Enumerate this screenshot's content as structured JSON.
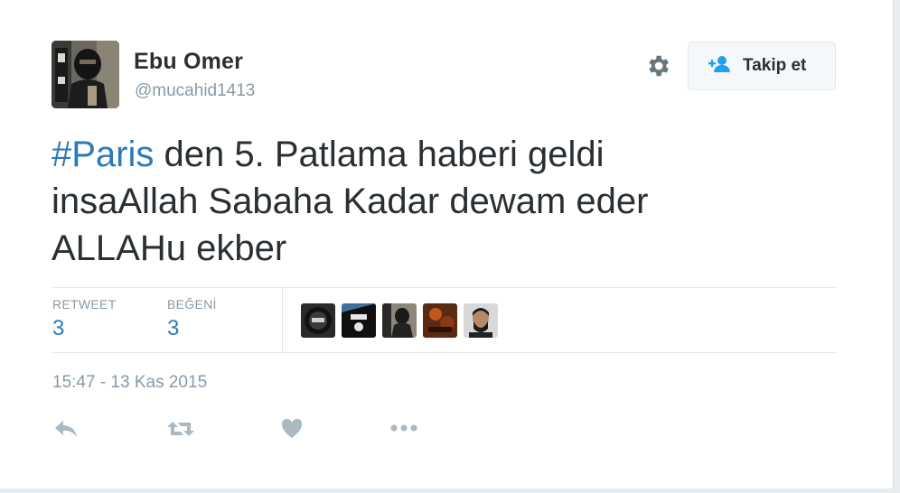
{
  "author": {
    "name": "Ebu Omer",
    "handle": "@mucahid1413",
    "avatar_icon": "profile-avatar"
  },
  "follow_button": {
    "label": "Takip et",
    "icon": "add-user-icon"
  },
  "settings_icon": "gear-icon",
  "tweet": {
    "hashtag": "#Paris",
    "line1_rest": " den 5. Patlama haberi geldi",
    "line2": "insaAllah Sabaha Kadar dewam eder",
    "line3": "ALLAHu ekber"
  },
  "stats": {
    "retweet_label": "RETWEET",
    "retweet_count": "3",
    "like_label": "BEĞENİ",
    "like_count": "3"
  },
  "likers": [
    "liker-avatar-1",
    "liker-avatar-2",
    "liker-avatar-3",
    "liker-avatar-4",
    "liker-avatar-5"
  ],
  "timestamp": "15:47 - 13 Kas 2015",
  "actions": [
    "reply-icon",
    "retweet-icon",
    "like-icon",
    "more-icon"
  ],
  "colors": {
    "link": "#2b7bb9",
    "muted": "#8899a6",
    "text": "#292f33",
    "action_icon": "#aab8c2"
  }
}
